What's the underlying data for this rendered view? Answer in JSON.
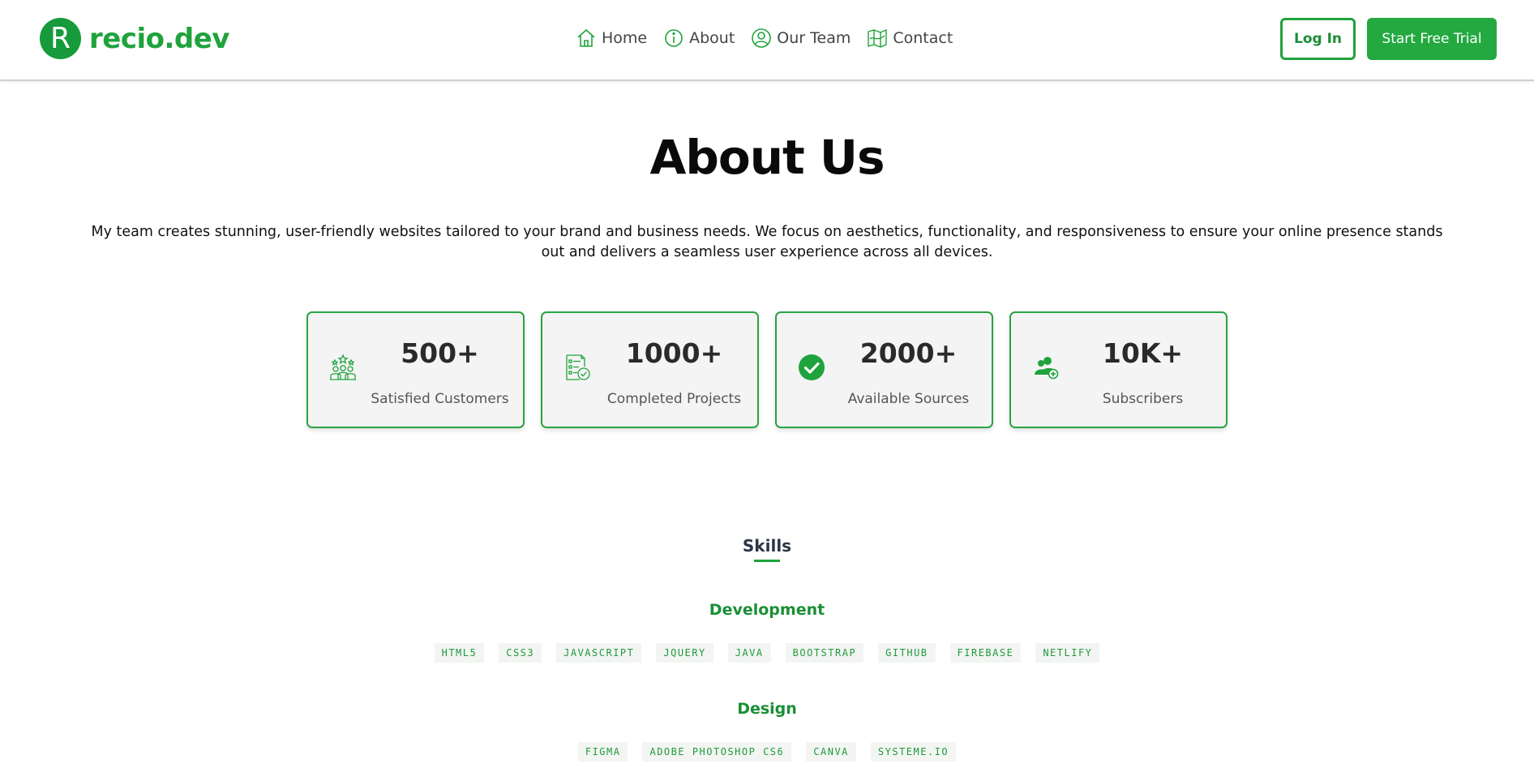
{
  "brand": {
    "mark": "R",
    "name": "recio.dev"
  },
  "nav": [
    {
      "label": "Home",
      "icon": "home-icon"
    },
    {
      "label": "About",
      "icon": "info-icon"
    },
    {
      "label": "Our Team",
      "icon": "user-circle-icon"
    },
    {
      "label": "Contact",
      "icon": "map-icon"
    }
  ],
  "actions": {
    "login": "Log In",
    "trial": "Start Free Trial"
  },
  "about": {
    "title": "About Us",
    "description": "My team creates stunning, user-friendly websites tailored to your brand and business needs. We focus on aesthetics, functionality, and responsiveness to ensure your online presence stands out and delivers a seamless user experience across all devices."
  },
  "stats": [
    {
      "value": "500+",
      "label": "Satisfied Customers",
      "icon": "customers-icon"
    },
    {
      "value": "1000+",
      "label": "Completed Projects",
      "icon": "projects-checklist-icon"
    },
    {
      "value": "2000+",
      "label": "Available Sources",
      "icon": "check-circle-icon"
    },
    {
      "value": "10K+",
      "label": "Subscribers",
      "icon": "subscribers-icon"
    }
  ],
  "skills": {
    "title": "Skills",
    "categories": [
      {
        "name": "Development",
        "tags": [
          "HTML5",
          "CSS3",
          "JAVASCRIPT",
          "JQUERY",
          "JAVA",
          "BOOTSTRAP",
          "GITHUB",
          "FIREBASE",
          "NETLIFY"
        ]
      },
      {
        "name": "Design",
        "tags": [
          "FIGMA",
          "ADOBE PHOTOSHOP CS6",
          "CANVA",
          "SYSTEME.IO"
        ]
      }
    ]
  },
  "colors": {
    "accent": "#1fa33c",
    "accent_dark": "#179a3b",
    "card_bg": "#f4f4f4"
  }
}
